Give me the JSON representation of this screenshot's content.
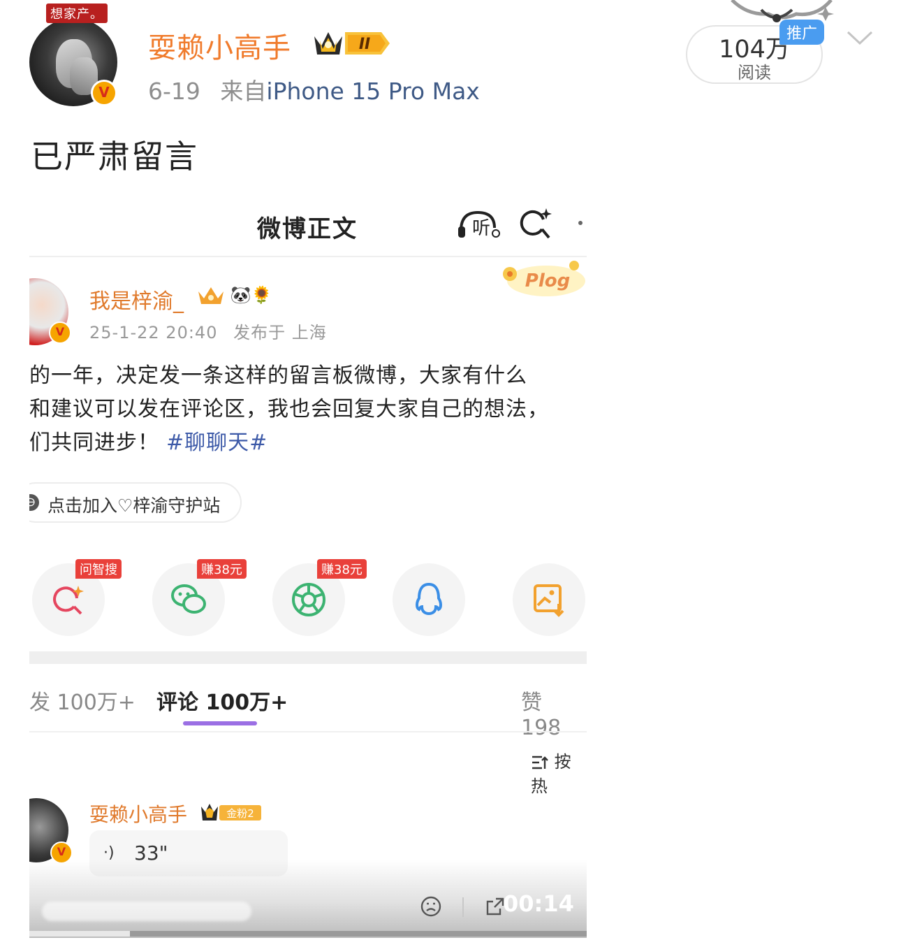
{
  "post": {
    "avatar_tag": "想家产。",
    "verified_mark": "V",
    "username": "耍赖小高手",
    "level_badge": "II",
    "date": "6-19",
    "source_prefix": "来自",
    "device": "iPhone 15 Pro Max",
    "read_count": "104万",
    "read_label": "阅读",
    "promo_tag": "推广",
    "text": "已严肃留言",
    "icons": [
      "crown-icon",
      "chevron-down-icon",
      "ornament-icon"
    ]
  },
  "screenshot": {
    "title": "微博正文",
    "listen_label": "听",
    "author": {
      "name": "我是梓渝_",
      "badges": "🐼🌻",
      "datetime": "25-1-22 20:40",
      "location_prefix": "发布于",
      "location": "上海",
      "sticker": "Plog"
    },
    "body_lines": [
      "的一年，决定发一条这样的留言板微博，大家有什么",
      "和建议可以发在评论区，我也会回复大家自己的想法，",
      "们共同进步！"
    ],
    "hashtag": "#聊聊天#",
    "join_label": "点击加入♡梓渝守护站",
    "share_targets": [
      {
        "name": "ai-search",
        "badge": "问智搜"
      },
      {
        "name": "wechat",
        "badge": "赚38元"
      },
      {
        "name": "moments",
        "badge": "赚38元"
      },
      {
        "name": "qq",
        "badge": ""
      },
      {
        "name": "save-image",
        "badge": ""
      }
    ],
    "tabs": {
      "repost": "发 100万+",
      "comments": "评论 100万+",
      "likes": "赞 198"
    },
    "sort_label": "按热",
    "comment": {
      "name": "耍赖小高手",
      "fan_badge": "金粉2",
      "voice_wave": "·)",
      "voice_duration": "33\""
    },
    "video": {
      "timecode": "00:14",
      "progress": 0.18
    }
  },
  "colors": {
    "username": "#f07b2c",
    "device_link": "#3f5a86",
    "hashtag": "#3d5aa8",
    "tab_underline": "#9b6fe4",
    "promo": "#4a9cf0",
    "share_badge": "#e9403a"
  }
}
